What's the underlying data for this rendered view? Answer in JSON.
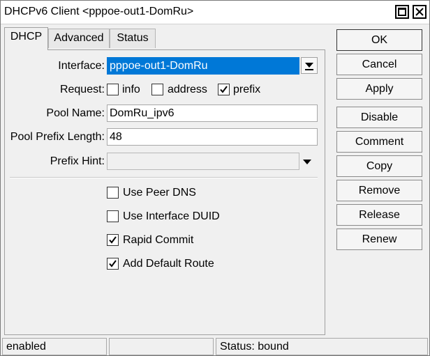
{
  "window": {
    "title": "DHCPv6 Client <pppoe-out1-DomRu>"
  },
  "tabs": [
    {
      "label": "DHCP",
      "active": true
    },
    {
      "label": "Advanced",
      "active": false
    },
    {
      "label": "Status",
      "active": false
    }
  ],
  "form": {
    "interface_label": "Interface:",
    "interface_value": "pppoe-out1-DomRu",
    "request_label": "Request:",
    "request_options": [
      {
        "label": "info",
        "checked": false
      },
      {
        "label": "address",
        "checked": false
      },
      {
        "label": "prefix",
        "checked": true
      }
    ],
    "pool_name_label": "Pool Name:",
    "pool_name_value": "DomRu_ipv6",
    "pool_prefix_length_label": "Pool Prefix Length:",
    "pool_prefix_length_value": "48",
    "prefix_hint_label": "Prefix Hint:",
    "prefix_hint_value": ""
  },
  "options": [
    {
      "label": "Use Peer DNS",
      "checked": false
    },
    {
      "label": "Use Interface DUID",
      "checked": false
    },
    {
      "label": "Rapid Commit",
      "checked": true
    },
    {
      "label": "Add Default Route",
      "checked": true
    }
  ],
  "buttons": {
    "ok": "OK",
    "cancel": "Cancel",
    "apply": "Apply",
    "disable": "Disable",
    "comment": "Comment",
    "copy": "Copy",
    "remove": "Remove",
    "release": "Release",
    "renew": "Renew"
  },
  "statusbar": {
    "state": "enabled",
    "middle": "",
    "status": "Status: bound"
  }
}
